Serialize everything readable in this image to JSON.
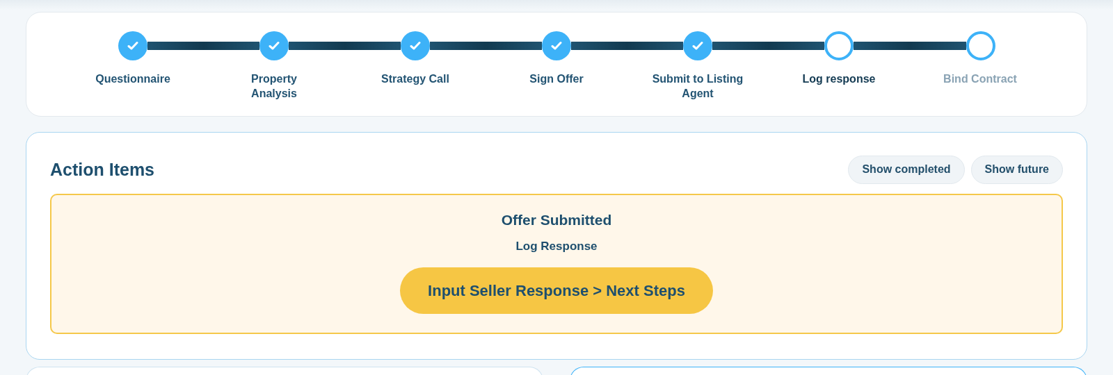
{
  "progress_steps": [
    {
      "label": "Questionnaire",
      "completed": true,
      "current": false
    },
    {
      "label": "Property Analysis",
      "completed": true,
      "current": false
    },
    {
      "label": "Strategy Call",
      "completed": true,
      "current": false
    },
    {
      "label": "Sign Offer",
      "completed": true,
      "current": false
    },
    {
      "label": "Submit to Listing Agent",
      "completed": true,
      "current": false
    },
    {
      "label": "Log response",
      "completed": false,
      "current": true
    },
    {
      "label": "Bind Contract",
      "completed": false,
      "current": false
    }
  ],
  "action_items": {
    "title": "Action Items",
    "filters": [
      {
        "label": "Show completed",
        "selected": false
      },
      {
        "label": "Show future",
        "selected": false
      }
    ],
    "current_item": {
      "heading": "Offer Submitted",
      "subheading": "Log Response",
      "action": "Input Seller Response > Next Steps"
    }
  }
}
